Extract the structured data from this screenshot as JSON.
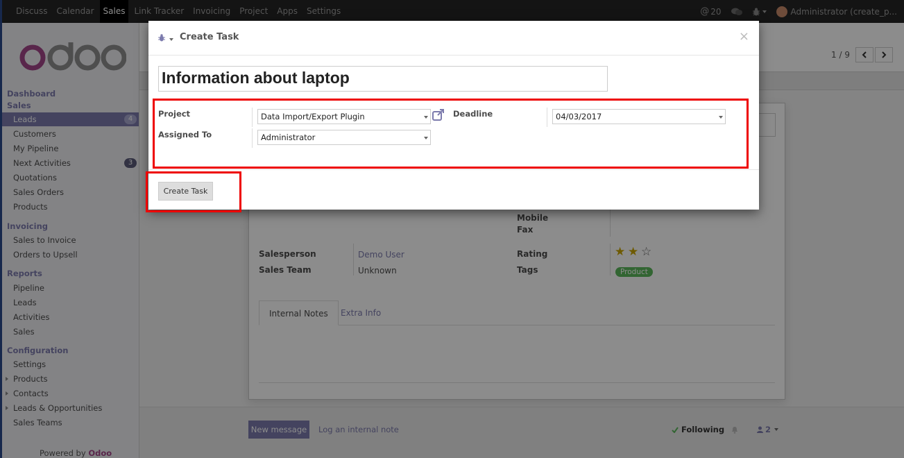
{
  "topbar": {
    "menu": [
      "Discuss",
      "Calendar",
      "Sales",
      "Link Tracker",
      "Invoicing",
      "Project",
      "Apps",
      "Settings"
    ],
    "active": "Sales",
    "mentions_count": "20",
    "user": "Administrator (create_p..."
  },
  "sidebar": {
    "logo": "odoo",
    "sections": [
      {
        "title": "Dashboard"
      },
      {
        "title": "Sales",
        "items": [
          {
            "label": "Leads",
            "badge": "4"
          },
          {
            "label": "Customers"
          },
          {
            "label": "My Pipeline"
          },
          {
            "label": "Next Activities",
            "badge": "3"
          },
          {
            "label": "Quotations"
          },
          {
            "label": "Sales Orders"
          },
          {
            "label": "Products"
          }
        ]
      },
      {
        "title": "Invoicing",
        "items": [
          {
            "label": "Sales to Invoice"
          },
          {
            "label": "Orders to Upsell"
          }
        ]
      },
      {
        "title": "Reports",
        "items": [
          {
            "label": "Pipeline"
          },
          {
            "label": "Leads"
          },
          {
            "label": "Activities"
          },
          {
            "label": "Sales"
          }
        ]
      },
      {
        "title": "Configuration",
        "items": [
          {
            "label": "Settings"
          },
          {
            "label": "Products"
          },
          {
            "label": "Contacts"
          },
          {
            "label": "Leads & Opportunities"
          },
          {
            "label": "Sales Teams"
          }
        ]
      }
    ],
    "powered_by": "Powered by",
    "powered_brand": "Odoo"
  },
  "pager": {
    "text": "1 / 9"
  },
  "form": {
    "mobile_label": "Mobile",
    "fax_label": "Fax",
    "salesperson_label": "Salesperson",
    "salesperson_value": "Demo User",
    "sales_team_label": "Sales Team",
    "sales_team_value": "Unknown",
    "rating_label": "Rating",
    "rating_value": 2,
    "rating_max": 3,
    "tags_label": "Tags",
    "tag": "Product",
    "tabs": [
      "Internal Notes",
      "Extra Info"
    ]
  },
  "chatter": {
    "new_message": "New message",
    "log_note": "Log an internal note",
    "following": "Following",
    "followers": "2"
  },
  "modal": {
    "title": "Create Task",
    "task_name": "Information about laptop",
    "project_label": "Project",
    "project_value": "Data Import/Export Plugin",
    "assigned_label": "Assigned To",
    "assigned_value": "Administrator",
    "deadline_label": "Deadline",
    "deadline_value": "04/03/2017",
    "create_button": "Create Task"
  },
  "colors": {
    "accent": "#7c7bad",
    "highlight": "#ee0000",
    "tag": "#5cb85c",
    "star": "#c8a400"
  }
}
